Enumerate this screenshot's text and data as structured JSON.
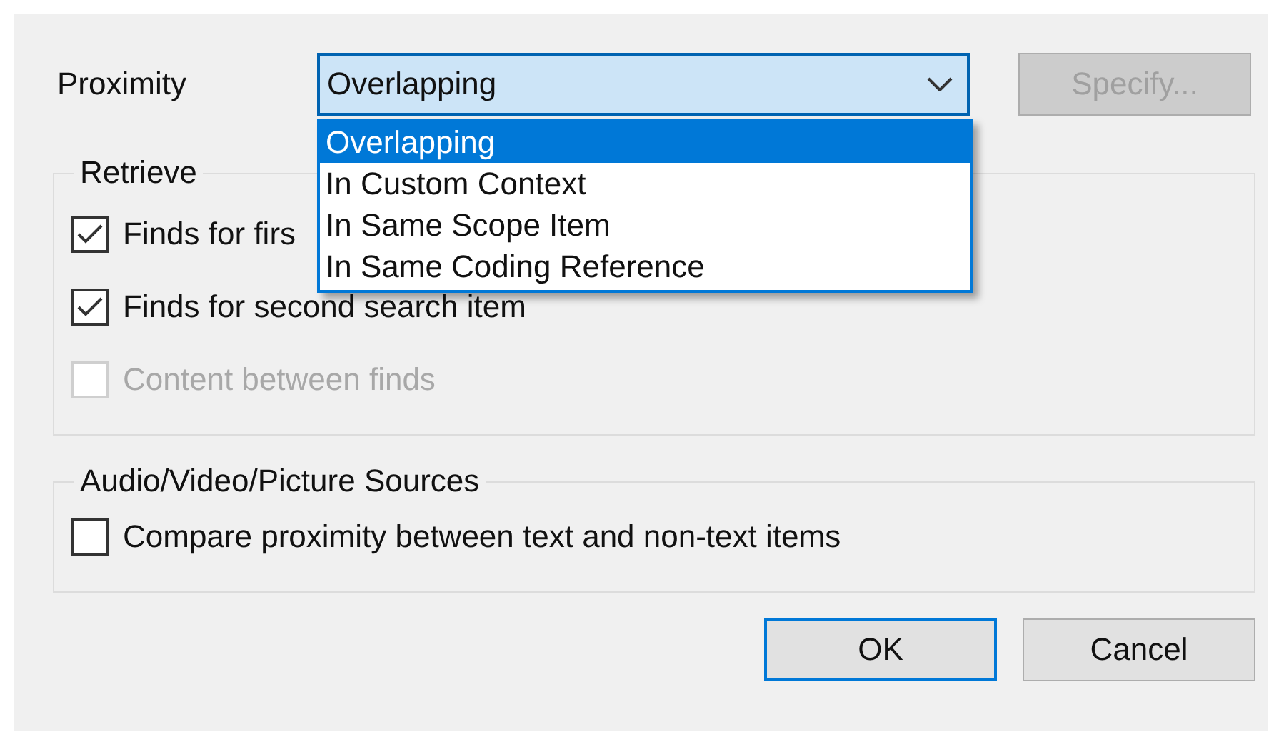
{
  "proximity": {
    "label": "Proximity",
    "value": "Overlapping",
    "expanded": true,
    "options": [
      {
        "label": "Overlapping",
        "selected": true
      },
      {
        "label": "In Custom Context",
        "selected": false
      },
      {
        "label": "In Same Scope Item",
        "selected": false
      },
      {
        "label": "In Same Coding Reference",
        "selected": false
      }
    ],
    "specify": {
      "label": "Specify...",
      "disabled": true
    }
  },
  "groups": [
    {
      "title": "Retrieve",
      "items": [
        {
          "label": "Finds for firs",
          "checked": true,
          "disabled": false
        },
        {
          "label": "Finds for second search item",
          "checked": true,
          "disabled": false
        },
        {
          "label": "Content between finds",
          "checked": false,
          "disabled": true
        }
      ]
    },
    {
      "title": "Audio/Video/Picture Sources",
      "items": [
        {
          "label": "Compare proximity between text and non-text items",
          "checked": false,
          "disabled": false
        }
      ]
    }
  ],
  "buttons": [
    {
      "label": "OK",
      "default": true
    },
    {
      "label": "Cancel",
      "default": false
    }
  ]
}
